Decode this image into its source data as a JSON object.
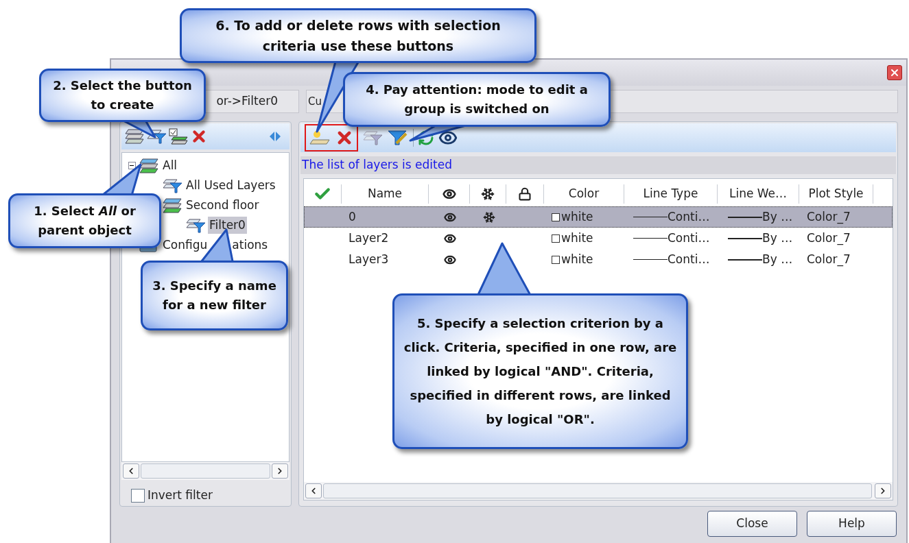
{
  "path_field": {
    "value": "or->Filter0"
  },
  "current_field": {
    "value": "Cu"
  },
  "tree": [
    {
      "label": "All",
      "kind": "layers",
      "expanded": true,
      "selected": false,
      "children": [
        {
          "label": "All Used Layers",
          "kind": "filter",
          "selected": false
        },
        {
          "label": "Second floor",
          "kind": "layers",
          "selected": false,
          "children": [
            {
              "label": "Filter0",
              "kind": "filter",
              "selected": true
            }
          ]
        }
      ]
    },
    {
      "label": "Configu",
      "label_end": "ations",
      "kind": "config",
      "selected": false
    }
  ],
  "invert_filter": {
    "label": "Invert filter",
    "checked": false
  },
  "status_text": "The list of layers is edited",
  "table": {
    "columns": [
      {
        "kind": "check"
      },
      {
        "kind": "text",
        "label": "Name"
      },
      {
        "kind": "eye"
      },
      {
        "kind": "freeze"
      },
      {
        "kind": "lock"
      },
      {
        "kind": "text",
        "label": "Color"
      },
      {
        "kind": "text",
        "label": "Line Type"
      },
      {
        "kind": "text",
        "label": "Line We…"
      },
      {
        "kind": "text",
        "label": "Plot Style"
      }
    ],
    "rows": [
      {
        "selected": true,
        "name": "0",
        "visible": true,
        "frozen": true,
        "color_name": "white",
        "line_type": "Conti…",
        "line_weight": "By …",
        "plot_style": "Color_7"
      },
      {
        "selected": false,
        "name": "Layer2",
        "visible": true,
        "frozen": false,
        "color_name": "white",
        "line_type": "Conti…",
        "line_weight": "By …",
        "plot_style": "Color_7"
      },
      {
        "selected": false,
        "name": "Layer3",
        "visible": true,
        "frozen": false,
        "color_name": "white",
        "line_type": "Conti…",
        "line_weight": "By …",
        "plot_style": "Color_7"
      }
    ]
  },
  "buttons": [
    "Close",
    "Help"
  ],
  "callouts": [
    {
      "text": "6. To add or delete rows with selection criteria use these buttons"
    },
    {
      "text": "2. Select the button to create"
    },
    {
      "text": "4. Pay attention: mode to edit a group is switched on"
    },
    {
      "text": "1. Select *All* or parent object"
    },
    {
      "text": "3. Specify a name for a new filter"
    },
    {
      "text": "5. Specify a selection criterion by a click. Criteria, specified in one row, are linked by logical \"AND\". Criteria, specified in different rows, are linked by logical \"OR\"."
    }
  ]
}
